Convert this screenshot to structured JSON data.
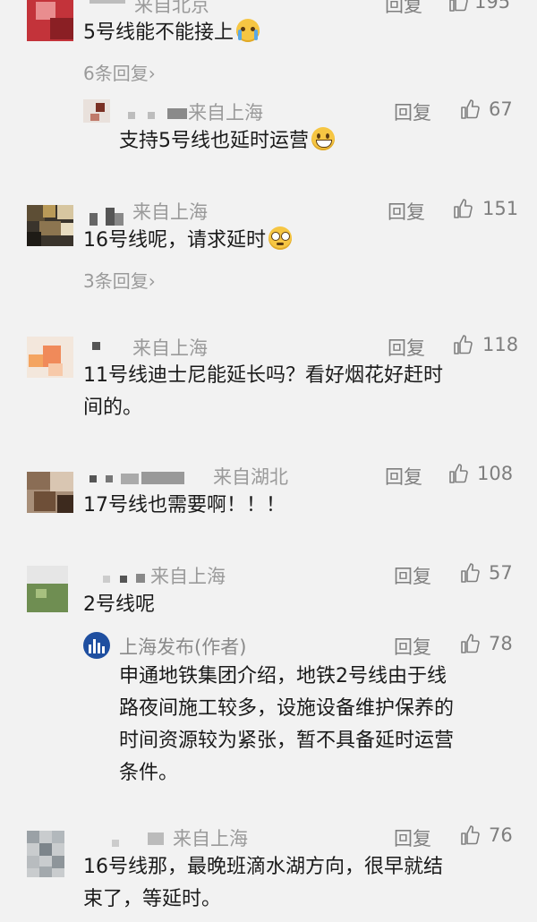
{
  "comments": [
    {
      "id": "c1",
      "region": "来自北京",
      "text": "5号线能不能接上",
      "reply": "回复",
      "likes": "195",
      "more": "6条回复",
      "chevron": "›"
    },
    {
      "id": "r1",
      "region": "来自上海",
      "text": "支持5号线也延时运营",
      "reply": "回复",
      "likes": "67"
    },
    {
      "id": "c2",
      "region": "来自上海",
      "text": "16号线呢，请求延时",
      "reply": "回复",
      "likes": "151",
      "more": "3条回复",
      "chevron": "›"
    },
    {
      "id": "c3",
      "region": "来自上海",
      "text_line1": "11号线迪士尼能延长吗？看好烟花好赶时",
      "text_line2": "间的。",
      "reply": "回复",
      "likes": "118"
    },
    {
      "id": "c4",
      "region": "来自湖北",
      "text": "17号线也需要啊！！！",
      "reply": "回复",
      "likes": "108"
    },
    {
      "id": "c5",
      "region": "来自上海",
      "text": "2号线呢",
      "reply": "回复",
      "likes": "57"
    },
    {
      "id": "r5",
      "author": "上海发布(作者)",
      "text_line1": "申通地铁集团介绍，地铁2号线由于线",
      "text_line2": "路夜间施工较多，设施设备维护保养的",
      "text_line3": "时间资源较为紧张，暂不具备延时运营",
      "text_line4": "条件。",
      "reply": "回复",
      "likes": "78"
    },
    {
      "id": "c6",
      "region": "来自上海",
      "text_line1": "16号线那，最晚班滴水湖方向，很早就结",
      "text_line2": "束了，等延时。",
      "reply": "回复",
      "likes": "76"
    }
  ],
  "icons": {
    "like": "thumbs-up-icon",
    "chevron": "chevron-right-icon"
  },
  "colors": {
    "background": "#f2f2f2",
    "meta": "#9a9a9a",
    "text": "#1a1a1a"
  }
}
